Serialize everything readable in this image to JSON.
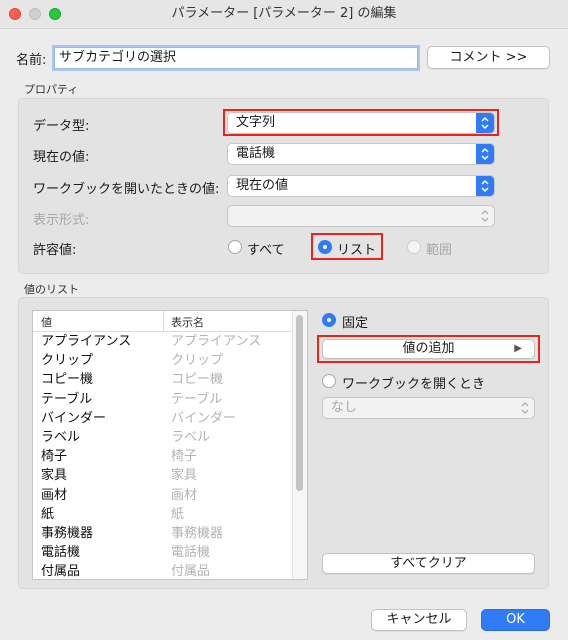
{
  "window": {
    "title": "パラメーター [パラメーター 2] の編集"
  },
  "name": {
    "label": "名前:",
    "value": "サブカテゴリの選択",
    "comment_button": "コメント >>"
  },
  "properties": {
    "section_label": "プロパティ",
    "data_type": {
      "label": "データ型:",
      "value": "文字列"
    },
    "current_value": {
      "label": "現在の値:",
      "value": "電話機"
    },
    "on_open": {
      "label": "ワークブックを開いたときの値:",
      "value": "現在の値"
    },
    "display_format": {
      "label": "表示形式:",
      "value": ""
    },
    "allowable": {
      "label": "許容値:",
      "options": [
        "すべて",
        "リスト",
        "範囲"
      ],
      "selected": "リスト"
    }
  },
  "value_list": {
    "section_label": "値のリスト",
    "columns": [
      "値",
      "表示名"
    ],
    "rows": [
      {
        "value": "アプライアンス",
        "display": "アプライアンス"
      },
      {
        "value": "クリップ",
        "display": "クリップ"
      },
      {
        "value": "コピー機",
        "display": "コピー機"
      },
      {
        "value": "テーブル",
        "display": "テーブル"
      },
      {
        "value": "バインダー",
        "display": "バインダー"
      },
      {
        "value": "ラベル",
        "display": "ラベル"
      },
      {
        "value": "椅子",
        "display": "椅子"
      },
      {
        "value": "家具",
        "display": "家具"
      },
      {
        "value": "画材",
        "display": "画材"
      },
      {
        "value": "紙",
        "display": "紙"
      },
      {
        "value": "事務機器",
        "display": "事務機器"
      },
      {
        "value": "電話機",
        "display": "電話機"
      },
      {
        "value": "付属品",
        "display": "付属品"
      }
    ],
    "fixed_label": "固定",
    "add_values_button": "値の追加",
    "on_open_label": "ワークブックを開くとき",
    "on_open_select": "なし",
    "clear_all_button": "すべてクリア"
  },
  "footer": {
    "cancel": "キャンセル",
    "ok": "OK"
  },
  "colors": {
    "accent": "#2f7cf6",
    "highlight": "#e8241b"
  }
}
